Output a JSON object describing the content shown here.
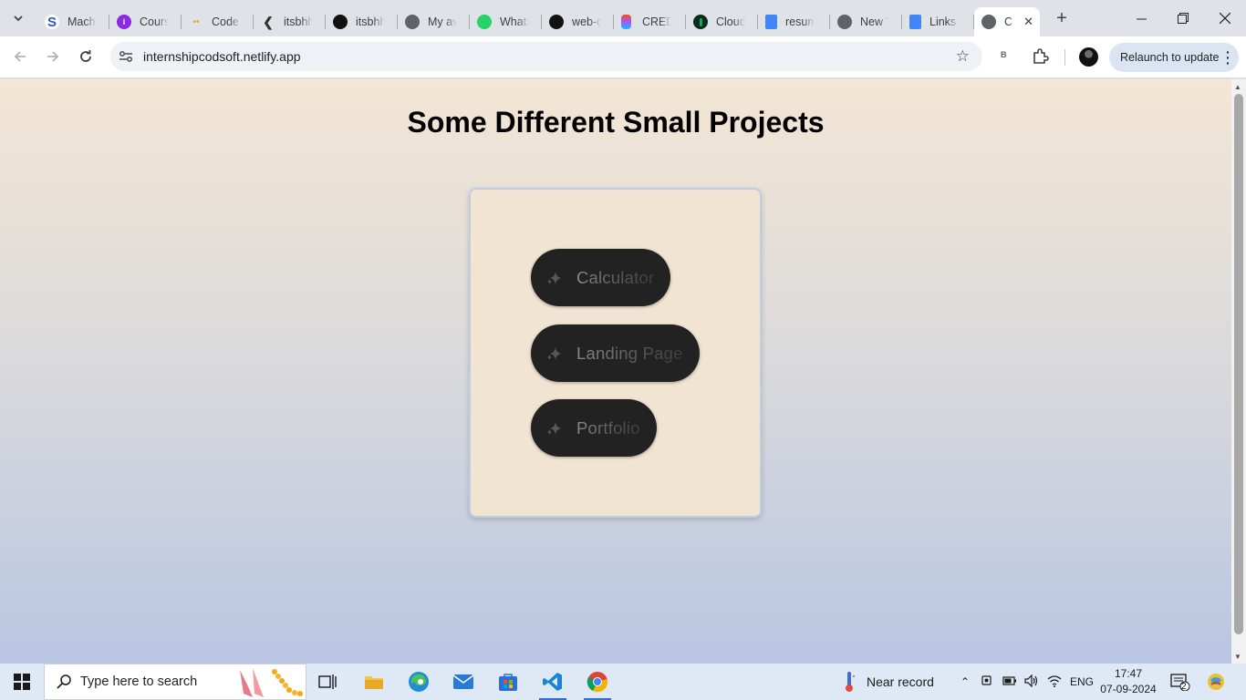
{
  "browser": {
    "tabs": [
      {
        "title": "Machi",
        "icon": "s-icon",
        "color": "#2b57e0"
      },
      {
        "title": "Cours",
        "icon": "course-icon",
        "color": "#8a2be2"
      },
      {
        "title": "Code",
        "icon": "code-icon",
        "color": "#e8a33d"
      },
      {
        "title": "itsbhh",
        "icon": "diamond-icon",
        "color": "#333333"
      },
      {
        "title": "itsbhh",
        "icon": "github-icon",
        "color": "#111111"
      },
      {
        "title": "My av",
        "icon": "globe-icon",
        "color": "#5f6368"
      },
      {
        "title": "Whats",
        "icon": "whatsapp-icon",
        "color": "#25d366"
      },
      {
        "title": "web-d",
        "icon": "github-icon",
        "color": "#111111"
      },
      {
        "title": "CREDI",
        "icon": "figma-icon",
        "color": "#f24e1e"
      },
      {
        "title": "Cloud",
        "icon": "mongodb-icon",
        "color": "#0c2b1c"
      },
      {
        "title": "resum",
        "icon": "docs-icon",
        "color": "#4285f4"
      },
      {
        "title": "New T",
        "icon": "chrome-icon",
        "color": "#5f6368"
      },
      {
        "title": "Links",
        "icon": "docs-icon",
        "color": "#4285f4"
      }
    ],
    "active_tab": {
      "title": "C",
      "icon": "globe-icon"
    },
    "url": "internshipcodsoft.netlify.app",
    "extension_label": "B",
    "relaunch_label": "Relaunch to update"
  },
  "page": {
    "title": "Some Different Small Projects",
    "projects": [
      {
        "label": "Calculator"
      },
      {
        "label": "Landing Page"
      },
      {
        "label": "Portfolio"
      }
    ]
  },
  "taskbar": {
    "search_placeholder": "Type here to search",
    "weather": "Near record",
    "language": "ENG",
    "time": "17:47",
    "date": "07-09-2024",
    "notification_count": "2"
  }
}
